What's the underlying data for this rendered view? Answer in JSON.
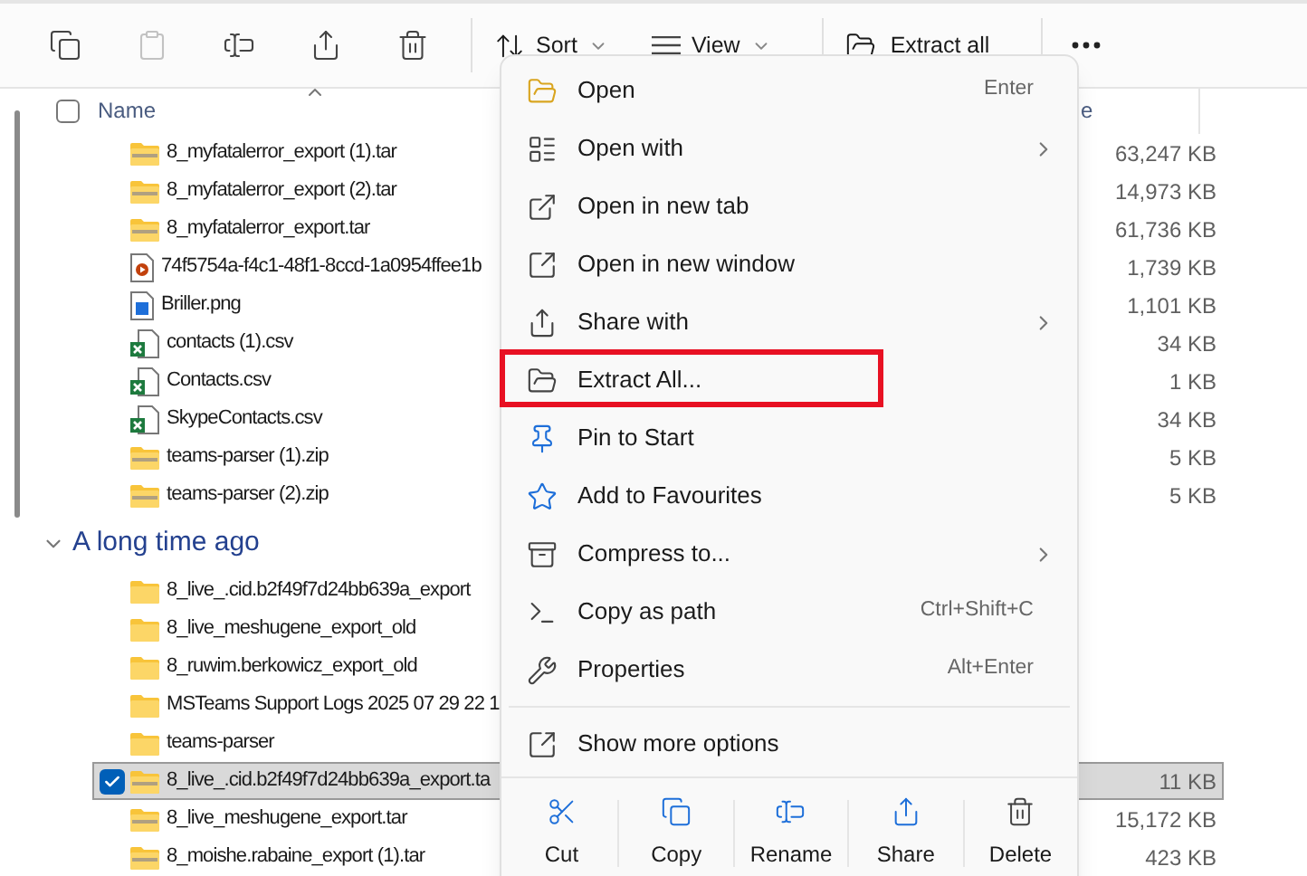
{
  "toolbar": {
    "buttons": [
      {
        "kind": "copy",
        "disabled": false
      },
      {
        "kind": "paste",
        "disabled": true
      },
      {
        "kind": "rename",
        "disabled": false
      },
      {
        "kind": "share",
        "disabled": false
      },
      {
        "kind": "delete",
        "disabled": false
      }
    ],
    "sort": {
      "label": "Sort"
    },
    "view": {
      "label": "View"
    },
    "extract": {
      "label": "Extract all"
    }
  },
  "columns": {
    "name": "Name",
    "column_2": "e",
    "all_checked": false
  },
  "files": [
    {
      "kind": "zip",
      "name": "8_myfatalerror_export (1).tar",
      "size": "63,247 KB",
      "selected": false
    },
    {
      "kind": "zip",
      "name": "8_myfatalerror_export (2).tar",
      "size": "14,973 KB",
      "selected": false
    },
    {
      "kind": "zip",
      "name": "8_myfatalerror_export.tar",
      "size": "61,736 KB",
      "selected": false
    },
    {
      "kind": "video",
      "name": "74f5754a-f4c1-48f1-8ccd-1a0954ffee1b",
      "size": "1,739 KB",
      "selected": false
    },
    {
      "kind": "image",
      "name": "Briller.png",
      "size": "1,101 KB",
      "selected": false
    },
    {
      "kind": "csv",
      "name": "contacts (1).csv",
      "size": "34 KB",
      "selected": false
    },
    {
      "kind": "csv",
      "name": "Contacts.csv",
      "size": "1 KB",
      "selected": false
    },
    {
      "kind": "csv",
      "name": "SkypeContacts.csv",
      "size": "34 KB",
      "selected": false
    },
    {
      "kind": "zip",
      "name": "teams-parser (1).zip",
      "size": "5 KB",
      "selected": false
    },
    {
      "kind": "zip",
      "name": "teams-parser (2).zip",
      "size": "5 KB",
      "selected": false
    }
  ],
  "group": {
    "title": "A long time ago",
    "expanded": true,
    "files": [
      {
        "kind": "folder",
        "name": "8_live_.cid.b2f49f7d24bb639a_export",
        "selected": false
      },
      {
        "kind": "folder",
        "name": "8_live_meshugene_export_old",
        "selected": false
      },
      {
        "kind": "folder",
        "name": "8_ruwim.berkowicz_export_old",
        "selected": false
      },
      {
        "kind": "folder",
        "name": "MSTeams Support Logs 2025 07 29 22 1",
        "selected": false
      },
      {
        "kind": "folder",
        "name": "teams-parser",
        "selected": false
      },
      {
        "kind": "zip",
        "name": "8_live_.cid.b2f49f7d24bb639a_export.ta",
        "size": "11 KB",
        "selected": true
      },
      {
        "kind": "zip",
        "name": "8_live_meshugene_export.tar",
        "size": "15,172 KB",
        "selected": false
      },
      {
        "kind": "zip",
        "name": "8_moishe.rabaine_export (1).tar",
        "size": "423 KB",
        "selected": false
      }
    ]
  },
  "menu": {
    "items": [
      {
        "kind": "open",
        "label": "Open",
        "shortcut": "Enter",
        "submenu": false,
        "highlighted": false
      },
      {
        "kind": "open-with",
        "label": "Open with",
        "submenu": true,
        "highlighted": false
      },
      {
        "kind": "new-tab",
        "label": "Open in new tab",
        "submenu": false,
        "highlighted": false
      },
      {
        "kind": "new-window",
        "label": "Open in new window",
        "submenu": false,
        "highlighted": false
      },
      {
        "kind": "share",
        "label": "Share with",
        "submenu": true,
        "highlighted": false
      },
      {
        "kind": "extract",
        "label": "Extract All...",
        "submenu": false,
        "highlighted": true
      },
      {
        "kind": "pin",
        "label": "Pin to Start",
        "submenu": false,
        "highlighted": false
      },
      {
        "kind": "star",
        "label": "Add to Favourites",
        "submenu": false,
        "highlighted": false
      },
      {
        "kind": "compress",
        "label": "Compress to...",
        "submenu": true,
        "highlighted": false
      },
      {
        "kind": "path",
        "label": "Copy as path",
        "shortcut": "Ctrl+Shift+C",
        "submenu": false,
        "highlighted": false
      },
      {
        "kind": "properties",
        "label": "Properties",
        "shortcut": "Alt+Enter",
        "submenu": false,
        "highlighted": false
      }
    ],
    "more": {
      "label": "Show more options"
    },
    "actions": [
      {
        "kind": "cut",
        "label": "Cut"
      },
      {
        "kind": "copy",
        "label": "Copy"
      },
      {
        "kind": "rename",
        "label": "Rename"
      },
      {
        "kind": "share",
        "label": "Share"
      },
      {
        "kind": "delete",
        "label": "Delete"
      }
    ]
  }
}
